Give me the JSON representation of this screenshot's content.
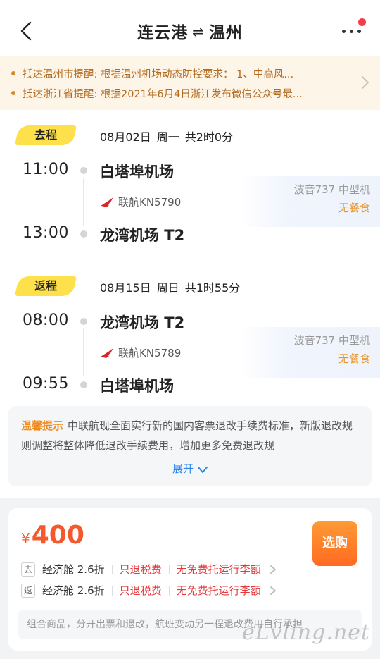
{
  "header": {
    "origin": "连云港",
    "destination": "温州",
    "swap_symbol": "⇌"
  },
  "notices": [
    "抵达温州市提醒: 根据温州机场动态防控要求： 1、中高风...",
    "抵达浙江省提醒: 根据2021年6月4日浙江发布微信公众号最..."
  ],
  "outbound": {
    "tag": "去程",
    "date": "08月02日",
    "weekday": "周一",
    "duration": "共2时0分",
    "depart_time": "11:00",
    "depart_airport": "白塔埠机场",
    "airline_flight": "联航KN5790",
    "aircraft": "波音737 中型机",
    "meal": "无餐食",
    "arrive_time": "13:00",
    "arrive_airport": "龙湾机场 T2"
  },
  "return": {
    "tag": "返程",
    "date": "08月15日",
    "weekday": "周日",
    "duration": "共1时55分",
    "depart_time": "08:00",
    "depart_airport": "龙湾机场 T2",
    "airline_flight": "联航KN5789",
    "aircraft": "波音737 中型机",
    "meal": "无餐食",
    "arrive_time": "09:55",
    "arrive_airport": "白塔埠机场"
  },
  "tip": {
    "label": "温馨提示",
    "text": "中联航现全面实行新的国内客票退改手续费标准，新版退改规则调整将整体降低退改手续费用，增加更多免费退改规",
    "expand_label": "展开"
  },
  "booking": {
    "currency": "¥",
    "price": "400",
    "buy_label": "选购",
    "rows": [
      {
        "dir": "去",
        "cabin": "经济舱 2.6折",
        "refund": "只退税费",
        "baggage": "无免费托运行李额"
      },
      {
        "dir": "返",
        "cabin": "经济舱 2.6折",
        "refund": "只退税费",
        "baggage": "无免费托运行李额"
      }
    ],
    "note": "组合商品，分开出票和退改，航班变动另一程退改费用自行承担"
  },
  "watermark": "eLvling.net",
  "colors": {
    "accent_orange": "#f4582c",
    "tag_yellow": "#fde04a",
    "link_blue": "#2f86e8",
    "alert_red": "#e4393c"
  }
}
